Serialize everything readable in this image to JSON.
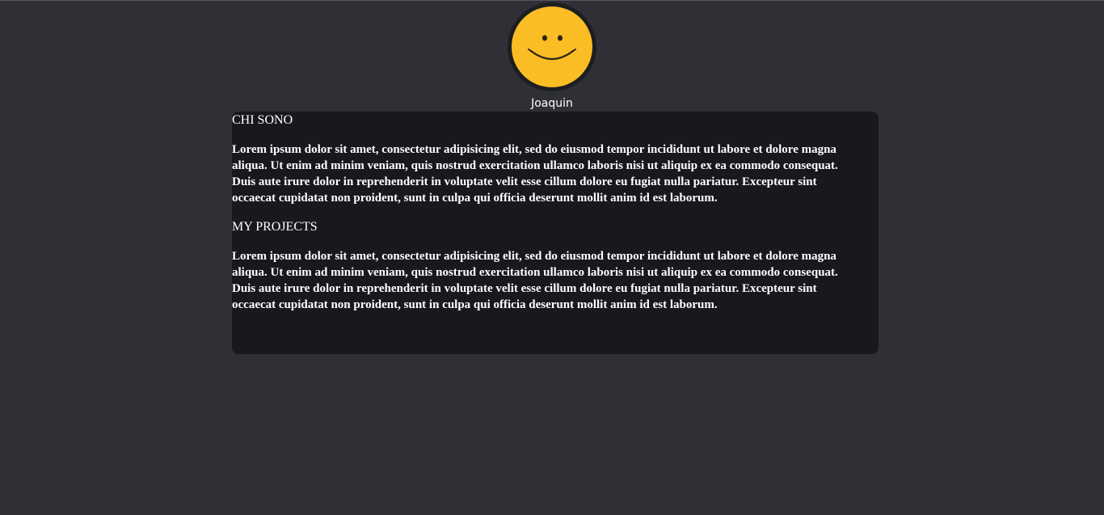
{
  "profile": {
    "avatar_icon": "smiley-face-icon",
    "name": "Joaquin",
    "colors": {
      "avatar_face": "#fbbd24",
      "avatar_ring": "#1d1e22"
    }
  },
  "card": {
    "sections": [
      {
        "title": "CHI SONO",
        "text": "Lorem ipsum dolor sit amet, consectetur adipisicing elit, sed do eiusmod tempor incididunt ut labore et dolore magna aliqua. Ut enim ad minim veniam, quis nostrud exercitation ullamco laboris nisi ut aliquip ex ea commodo consequat. Duis aute irure dolor in reprehenderit in voluptate velit esse cillum dolore eu fugiat nulla pariatur. Excepteur sint occaecat cupidatat non proident, sunt in culpa qui officia deserunt mollit anim id est laborum."
      },
      {
        "title": "MY PROJECTS",
        "text": "Lorem ipsum dolor sit amet, consectetur adipisicing elit, sed do eiusmod tempor incididunt ut labore et dolore magna aliqua. Ut enim ad minim veniam, quis nostrud exercitation ullamco laboris nisi ut aliquip ex ea commodo consequat. Duis aute irure dolor in reprehenderit in voluptate velit esse cillum dolore eu fugiat nulla pariatur. Excepteur sint occaecat cupidatat non proident, sunt in culpa qui officia deserunt mollit anim id est laborum."
      }
    ]
  },
  "colors": {
    "page_background": "#2f3036",
    "card_background": "#18191d",
    "text": "#ffffff"
  }
}
